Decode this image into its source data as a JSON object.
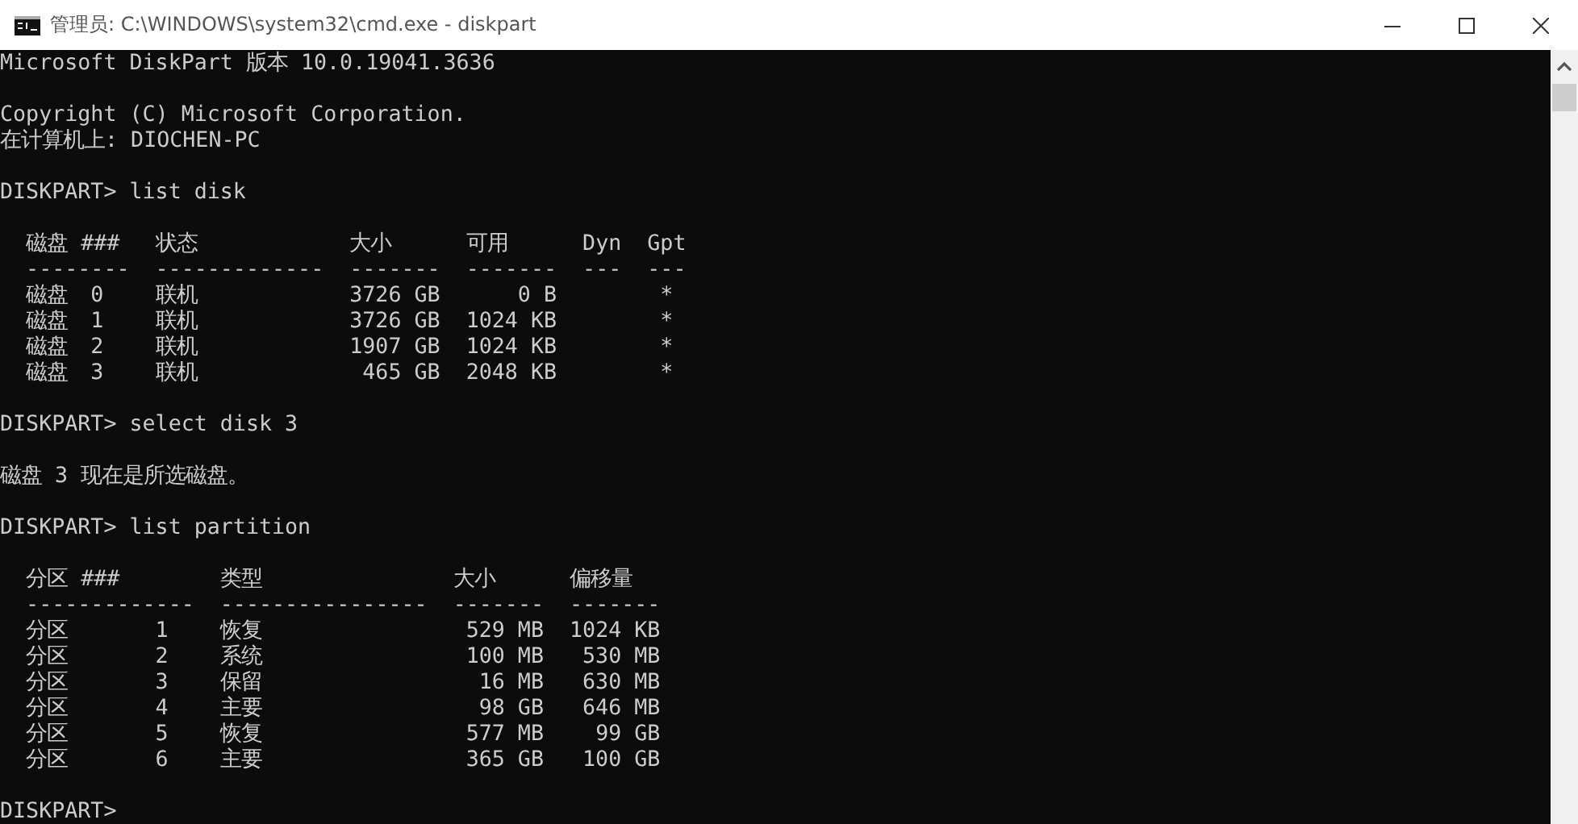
{
  "window": {
    "title": "管理员: C:\\WINDOWS\\system32\\cmd.exe - diskpart"
  },
  "console": [
    {
      "kind": "text",
      "lines": [
        "Microsoft DiskPart 版本 10.0.19041.3636"
      ]
    },
    {
      "kind": "text",
      "lines": [
        "Copyright (C) Microsoft Corporation.",
        "在计算机上: DIOCHEN-PC"
      ]
    },
    {
      "kind": "command",
      "prompt": "DISKPART>",
      "command": "list disk"
    },
    {
      "kind": "disk_table",
      "columns": [
        {
          "label": "磁盘 ###",
          "rule": "--------"
        },
        {
          "label": "状态",
          "rule": "-------------"
        },
        {
          "label": "大小",
          "rule": "-------"
        },
        {
          "label": "可用",
          "rule": "-------"
        },
        {
          "label": "Dyn",
          "rule": "---"
        },
        {
          "label": "Gpt",
          "rule": "---"
        }
      ],
      "rows": [
        {
          "label": "磁盘",
          "number": "0",
          "status": "联机",
          "size": "3726 GB",
          "free": "0 B",
          "gpt": "*"
        },
        {
          "label": "磁盘",
          "number": "1",
          "status": "联机",
          "size": "3726 GB",
          "free": "1024 KB",
          "gpt": "*"
        },
        {
          "label": "磁盘",
          "number": "2",
          "status": "联机",
          "size": "1907 GB",
          "free": "1024 KB",
          "gpt": "*"
        },
        {
          "label": "磁盘",
          "number": "3",
          "status": "联机",
          "size": "465 GB",
          "free": "2048 KB",
          "gpt": "*"
        }
      ]
    },
    {
      "kind": "command",
      "prompt": "DISKPART>",
      "command": "select disk 3"
    },
    {
      "kind": "text",
      "lines": [
        "磁盘 3 现在是所选磁盘。"
      ]
    },
    {
      "kind": "command",
      "prompt": "DISKPART>",
      "command": "list partition"
    },
    {
      "kind": "partition_table",
      "columns": [
        {
          "label": "分区 ###",
          "rule": "-------------"
        },
        {
          "label": "类型",
          "rule": "----------------"
        },
        {
          "label": "大小",
          "rule": "-------"
        },
        {
          "label": "偏移量",
          "rule": "-------"
        }
      ],
      "rows": [
        {
          "label": "分区",
          "number": "1",
          "type": "恢复",
          "size": "529 MB",
          "offset": "1024 KB"
        },
        {
          "label": "分区",
          "number": "2",
          "type": "系统",
          "size": "100 MB",
          "offset": "530 MB"
        },
        {
          "label": "分区",
          "number": "3",
          "type": "保留",
          "size": "16 MB",
          "offset": "630 MB"
        },
        {
          "label": "分区",
          "number": "4",
          "type": "主要",
          "size": "98 GB",
          "offset": "646 MB"
        },
        {
          "label": "分区",
          "number": "5",
          "type": "恢复",
          "size": "577 MB",
          "offset": "99 GB"
        },
        {
          "label": "分区",
          "number": "6",
          "type": "主要",
          "size": "365 GB",
          "offset": "100 GB"
        }
      ]
    },
    {
      "kind": "command",
      "prompt": "DISKPART>"
    }
  ]
}
